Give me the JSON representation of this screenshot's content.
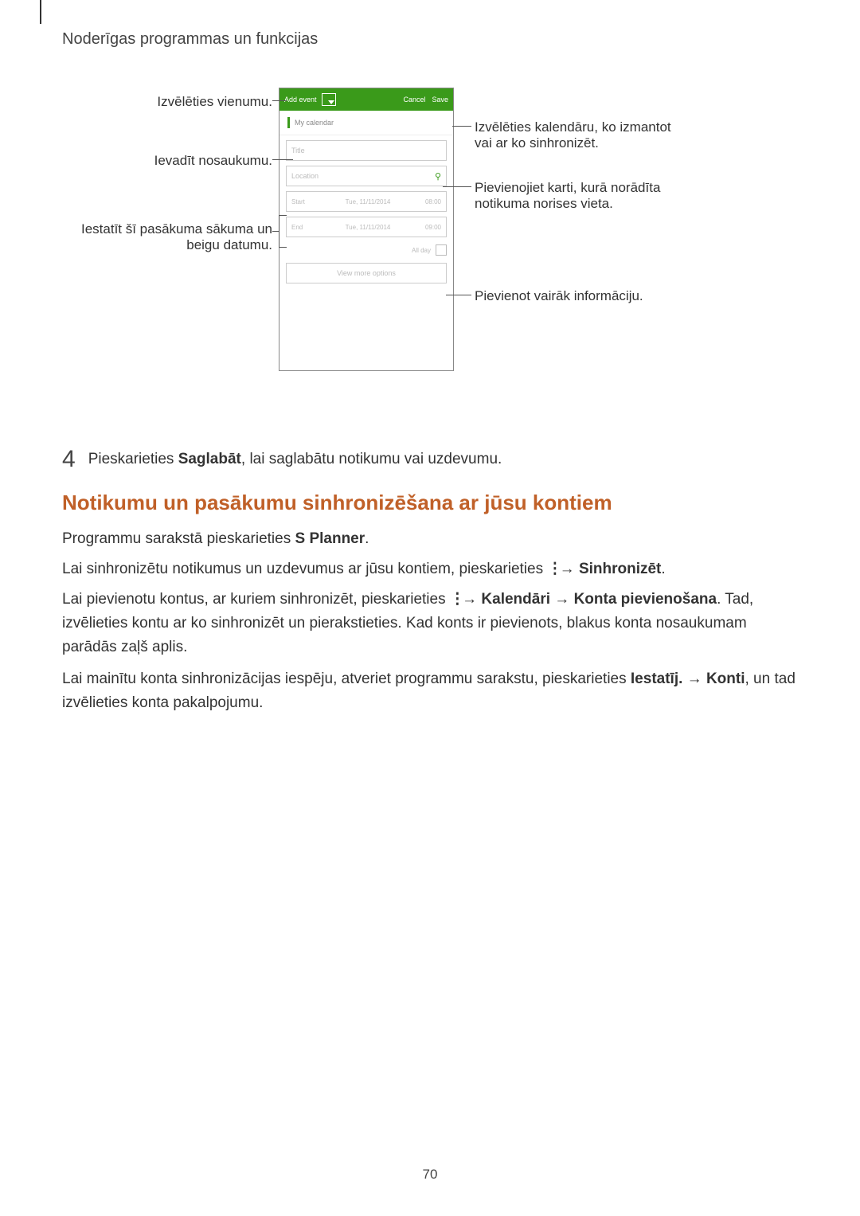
{
  "header": {
    "title": "Noderīgas programmas un funkcijas"
  },
  "phone": {
    "add_event": "Add event",
    "cancel": "Cancel",
    "save": "Save",
    "my_calendar": "My calendar",
    "title_placeholder": "Title",
    "location_placeholder": "Location",
    "start_label": "Start",
    "start_date": "Tue, 11/11/2014",
    "start_time": "08:00",
    "end_label": "End",
    "end_date": "Tue, 11/11/2014",
    "end_time": "09:00",
    "all_day": "All day",
    "view_more": "View more options"
  },
  "callouts": {
    "select_item": "Izvēlēties vienumu.",
    "enter_name": "Ievadīt nosaukumu.",
    "set_dates_line1": "Iestatīt šī pasākuma sākuma un",
    "set_dates_line2": "beigu datumu.",
    "select_calendar_line1": "Izvēlēties kalendāru, ko izmantot",
    "select_calendar_line2": "vai ar ko sinhronizēt.",
    "add_map_line1": "Pievienojiet karti, kurā norādīta",
    "add_map_line2": "notikuma norises vieta.",
    "add_info": "Pievienot vairāk informāciju."
  },
  "step": {
    "number": "4",
    "text_before": "Pieskarieties ",
    "bold": "Saglabāt",
    "text_after": ", lai saglabātu notikumu vai uzdevumu."
  },
  "section_title": "Notikumu un pasākumu sinhronizēšana ar jūsu kontiem",
  "paragraphs": {
    "p1_before": "Programmu sarakstā pieskarieties ",
    "p1_bold": "S Planner",
    "p1_after": ".",
    "p2_before": "Lai sinhronizētu notikumus un uzdevumus ar jūsu kontiem, pieskarieties ",
    "p2_arrow": " → ",
    "p2_bold": "Sinhronizēt",
    "p2_after": ".",
    "p3_before": "Lai pievienotu kontus, ar kuriem sinhronizēt, pieskarieties ",
    "p3_arrow1": " → ",
    "p3_bold1": "Kalendāri",
    "p3_arrow2": " → ",
    "p3_bold2": "Konta pievienošana",
    "p3_after1": ". Tad, izvēlieties kontu ar ko sinhronizēt un pierakstieties. Kad konts ir pievienots, blakus konta nosaukumam parādās zaļš aplis.",
    "p4_before": "Lai mainītu konta sinhronizācijas iespēju, atveriet programmu sarakstu, pieskarieties ",
    "p4_bold1": "Iestatīj.",
    "p4_arrow": " → ",
    "p4_bold2": "Konti",
    "p4_after": ", un tad izvēlieties konta pakalpojumu."
  },
  "page_number": "70",
  "icons": {
    "dots": "⋮",
    "arrow": "→",
    "pin": "📍"
  }
}
